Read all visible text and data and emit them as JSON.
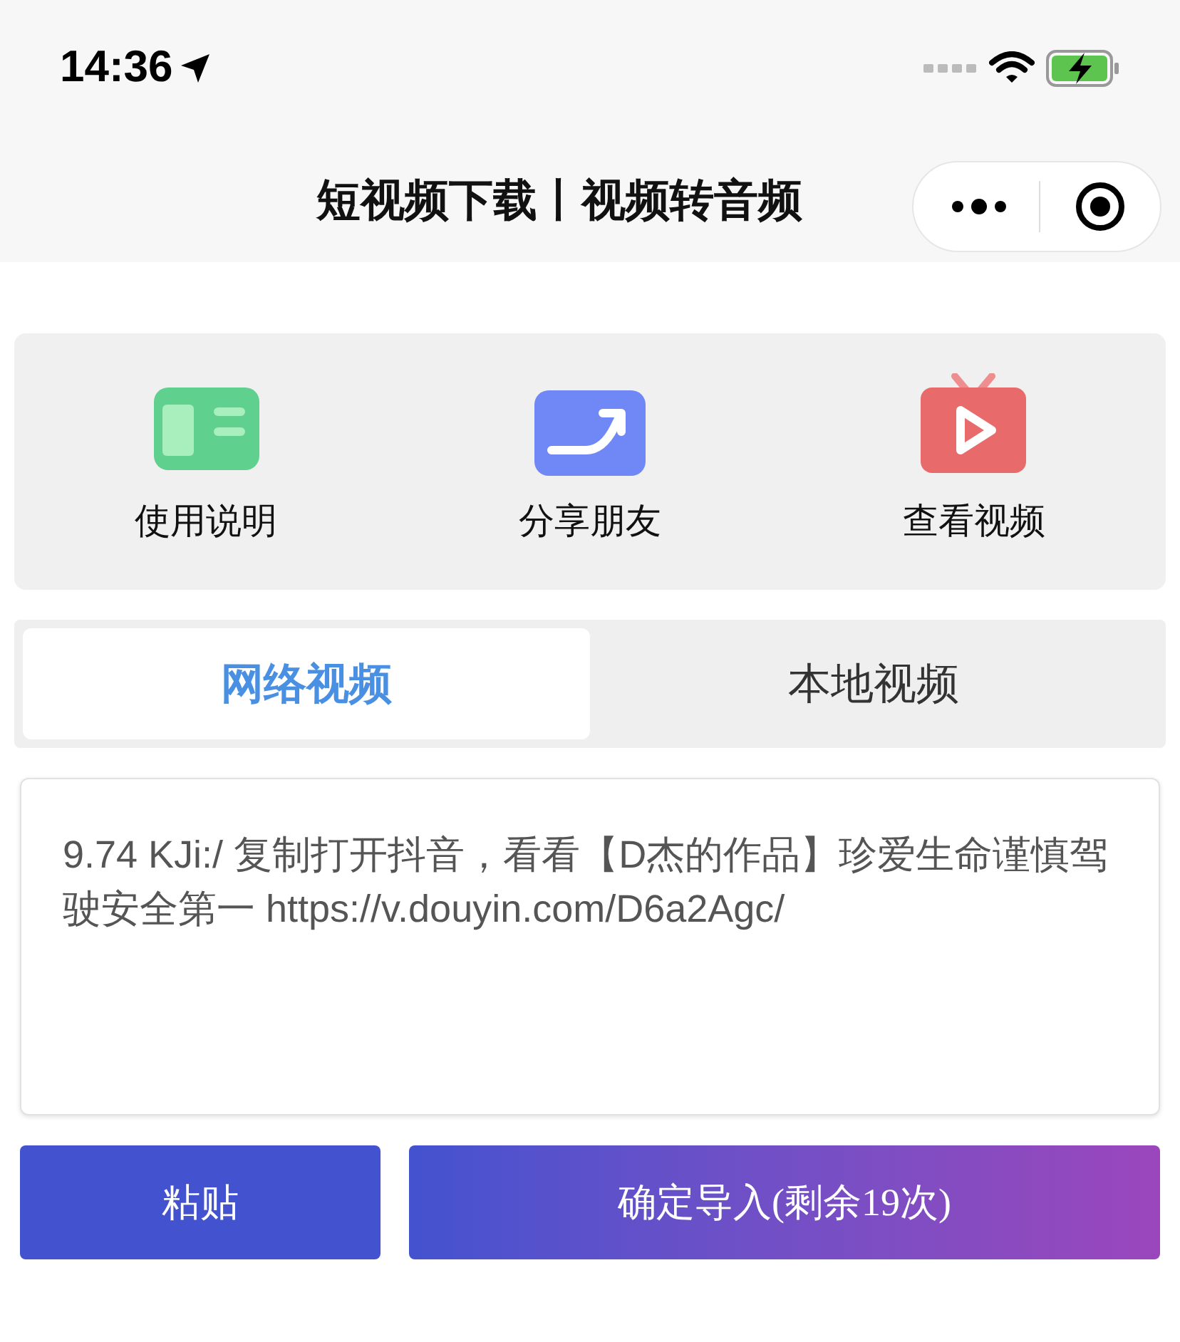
{
  "status_bar": {
    "time": "14:36"
  },
  "nav_bar": {
    "title": "短视频下载丨视频转音频"
  },
  "shortcuts": [
    {
      "kind": "book",
      "label": "使用说明"
    },
    {
      "kind": "share",
      "label": "分享朋友"
    },
    {
      "kind": "tv",
      "label": "查看视频"
    }
  ],
  "tabs": [
    {
      "label": "网络视频",
      "selected": true
    },
    {
      "label": "本地视频",
      "selected": false
    }
  ],
  "link_field": {
    "value": "9.74 KJi:/ 复制打开抖音，看看【D杰的作品】珍爱生命谨慎驾驶安全第一  https://v.douyin.com/D6a2Agc/"
  },
  "buttons": [
    {
      "kind": "paste",
      "label": "粘贴"
    },
    {
      "kind": "import",
      "label": "确定导入(剩余19次)"
    }
  ]
}
